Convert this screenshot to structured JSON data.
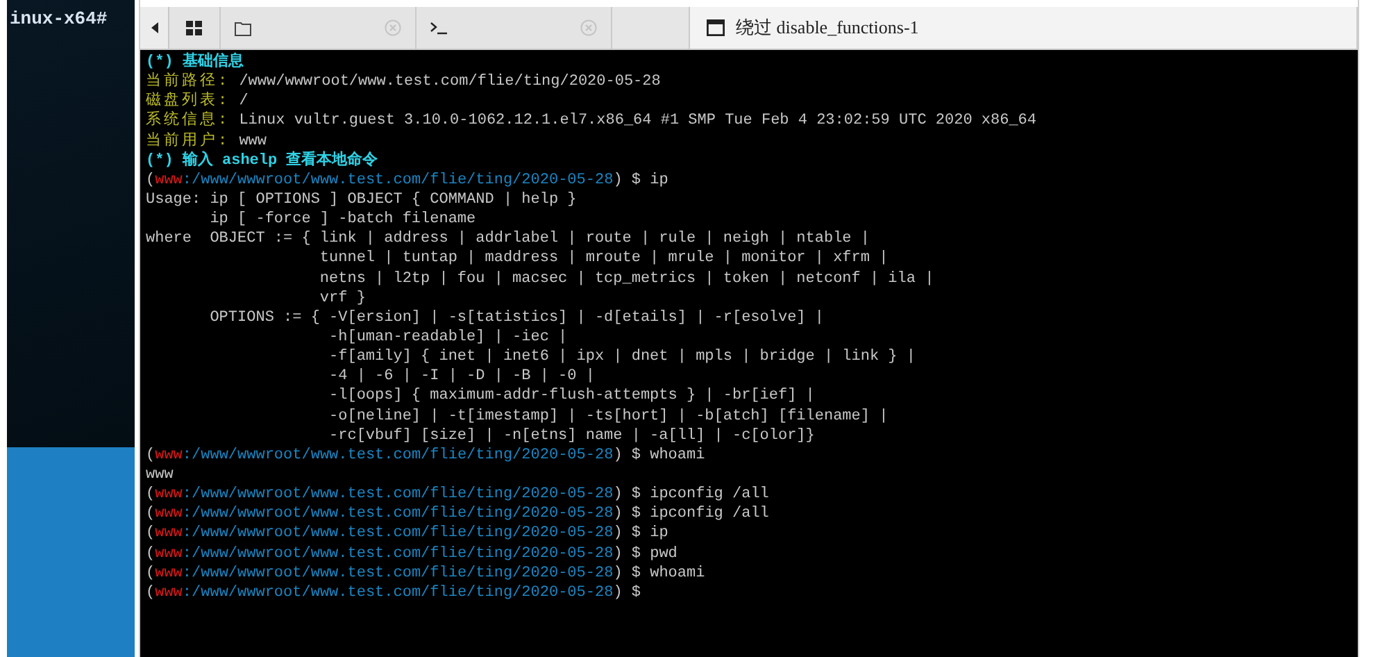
{
  "desktop": {
    "terminal_text": "inux-x64#"
  },
  "tabs": [
    {
      "kind": "home",
      "selected": false,
      "closable": false
    },
    {
      "kind": "file",
      "selected": false,
      "closable": true
    },
    {
      "kind": "terminal",
      "selected": false,
      "closable": true
    },
    {
      "kind": "window",
      "title": "绕过 disable_functions-1",
      "selected": true,
      "closable": false
    }
  ],
  "terminal": {
    "lines": [
      {
        "segments": [
          {
            "kind": "heading",
            "text": "(*) 基础信息"
          }
        ]
      },
      {
        "segments": [
          {
            "kind": "label",
            "text": "当前路径:"
          },
          {
            "kind": "output",
            "text": " /www/wwwroot/www.test.com/flie/ting/2020-05-28"
          }
        ]
      },
      {
        "segments": [
          {
            "kind": "label",
            "text": "磁盘列表:"
          },
          {
            "kind": "output",
            "text": " /"
          }
        ]
      },
      {
        "segments": [
          {
            "kind": "label",
            "text": "系统信息:"
          },
          {
            "kind": "output",
            "text": " Linux vultr.guest 3.10.0-1062.12.1.el7.x86_64 #1 SMP Tue Feb 4 23:02:59 UTC 2020 x86_64"
          }
        ]
      },
      {
        "segments": [
          {
            "kind": "label",
            "text": "当前用户:"
          },
          {
            "kind": "output",
            "text": " www"
          }
        ]
      },
      {
        "segments": [
          {
            "kind": "heading",
            "text": "(*) 输入 ashelp 查看本地命令"
          }
        ]
      },
      {
        "segments": [
          {
            "kind": "output",
            "text": "("
          },
          {
            "kind": "user",
            "text": "www"
          },
          {
            "kind": "path",
            "text": ":/www/wwwroot/www.test.com/flie/ting/2020-05-28"
          },
          {
            "kind": "output",
            "text": ") $ ip"
          }
        ]
      },
      {
        "segments": [
          {
            "kind": "output",
            "text": "Usage: ip [ OPTIONS ] OBJECT { COMMAND | help }"
          }
        ]
      },
      {
        "segments": [
          {
            "kind": "output",
            "text": "       ip [ -force ] -batch filename"
          }
        ]
      },
      {
        "segments": [
          {
            "kind": "output",
            "text": "where  OBJECT := { link | address | addrlabel | route | rule | neigh | ntable |"
          }
        ]
      },
      {
        "segments": [
          {
            "kind": "output",
            "text": "                   tunnel | tuntap | maddress | mroute | mrule | monitor | xfrm |"
          }
        ]
      },
      {
        "segments": [
          {
            "kind": "output",
            "text": "                   netns | l2tp | fou | macsec | tcp_metrics | token | netconf | ila |"
          }
        ]
      },
      {
        "segments": [
          {
            "kind": "output",
            "text": "                   vrf }"
          }
        ]
      },
      {
        "segments": [
          {
            "kind": "output",
            "text": "       OPTIONS := { -V[ersion] | -s[tatistics] | -d[etails] | -r[esolve] |"
          }
        ]
      },
      {
        "segments": [
          {
            "kind": "output",
            "text": "                    -h[uman-readable] | -iec |"
          }
        ]
      },
      {
        "segments": [
          {
            "kind": "output",
            "text": "                    -f[amily] { inet | inet6 | ipx | dnet | mpls | bridge | link } |"
          }
        ]
      },
      {
        "segments": [
          {
            "kind": "output",
            "text": "                    -4 | -6 | -I | -D | -B | -0 |"
          }
        ]
      },
      {
        "segments": [
          {
            "kind": "output",
            "text": "                    -l[oops] { maximum-addr-flush-attempts } | -br[ief] |"
          }
        ]
      },
      {
        "segments": [
          {
            "kind": "output",
            "text": "                    -o[neline] | -t[imestamp] | -ts[hort] | -b[atch] [filename] |"
          }
        ]
      },
      {
        "segments": [
          {
            "kind": "output",
            "text": "                    -rc[vbuf] [size] | -n[etns] name | -a[ll] | -c[olor]}"
          }
        ]
      },
      {
        "segments": [
          {
            "kind": "output",
            "text": "("
          },
          {
            "kind": "user",
            "text": "www"
          },
          {
            "kind": "path",
            "text": ":/www/wwwroot/www.test.com/flie/ting/2020-05-28"
          },
          {
            "kind": "output",
            "text": ") $ whoami"
          }
        ]
      },
      {
        "segments": [
          {
            "kind": "output",
            "text": "www"
          }
        ]
      },
      {
        "segments": [
          {
            "kind": "output",
            "text": "("
          },
          {
            "kind": "user",
            "text": "www"
          },
          {
            "kind": "path",
            "text": ":/www/wwwroot/www.test.com/flie/ting/2020-05-28"
          },
          {
            "kind": "output",
            "text": ") $ ipconfig /all"
          }
        ]
      },
      {
        "segments": [
          {
            "kind": "output",
            "text": "("
          },
          {
            "kind": "user",
            "text": "www"
          },
          {
            "kind": "path",
            "text": ":/www/wwwroot/www.test.com/flie/ting/2020-05-28"
          },
          {
            "kind": "output",
            "text": ") $ ipconfig /all"
          }
        ]
      },
      {
        "segments": [
          {
            "kind": "output",
            "text": "("
          },
          {
            "kind": "user",
            "text": "www"
          },
          {
            "kind": "path",
            "text": ":/www/wwwroot/www.test.com/flie/ting/2020-05-28"
          },
          {
            "kind": "output",
            "text": ") $ ip"
          }
        ]
      },
      {
        "segments": [
          {
            "kind": "output",
            "text": "("
          },
          {
            "kind": "user",
            "text": "www"
          },
          {
            "kind": "path",
            "text": ":/www/wwwroot/www.test.com/flie/ting/2020-05-28"
          },
          {
            "kind": "output",
            "text": ") $ pwd"
          }
        ]
      },
      {
        "segments": [
          {
            "kind": "output",
            "text": "("
          },
          {
            "kind": "user",
            "text": "www"
          },
          {
            "kind": "path",
            "text": ":/www/wwwroot/www.test.com/flie/ting/2020-05-28"
          },
          {
            "kind": "output",
            "text": ") $ whoami"
          }
        ]
      },
      {
        "segments": [
          {
            "kind": "output",
            "text": "("
          },
          {
            "kind": "user",
            "text": "www"
          },
          {
            "kind": "path",
            "text": ":/www/wwwroot/www.test.com/flie/ting/2020-05-28"
          },
          {
            "kind": "output",
            "text": ") $"
          }
        ]
      }
    ]
  }
}
